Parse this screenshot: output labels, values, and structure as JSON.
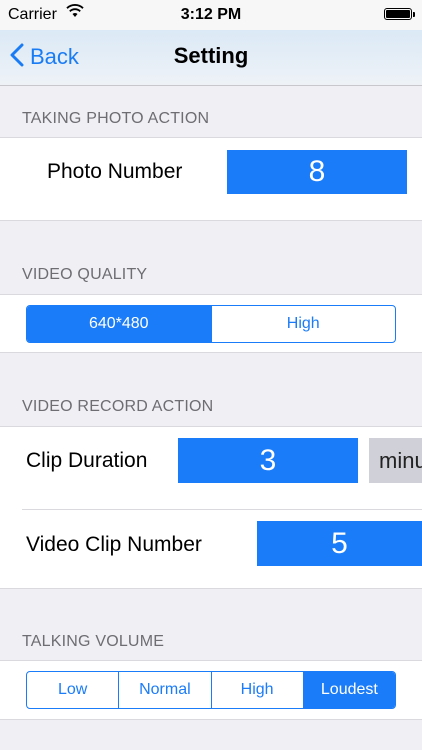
{
  "status_bar": {
    "carrier": "Carrier",
    "time": "3:12 PM"
  },
  "nav": {
    "back_label": "Back",
    "title": "Setting"
  },
  "photo_section": {
    "header": "TAKING PHOTO ACTION",
    "label": "Photo Number",
    "value": "8"
  },
  "quality_section": {
    "header": "VIDEO QUALITY",
    "options": [
      "640*480",
      "High"
    ],
    "selected": "640*480"
  },
  "record_section": {
    "header": "VIDEO RECORD ACTION",
    "clip_duration_label": "Clip Duration",
    "clip_duration_value": "3",
    "clip_duration_unit": "minu",
    "clip_number_label": "Video Clip Number",
    "clip_number_value": "5"
  },
  "volume_section": {
    "header": "TALKING VOLUME",
    "options": [
      "Low",
      "Normal",
      "High",
      "Loudest"
    ],
    "selected": "Loudest"
  },
  "colors": {
    "accent": "#1b7cf9",
    "background": "#efeff4",
    "header_text": "#6d6d72",
    "unit_field": "#cfd0d8"
  }
}
